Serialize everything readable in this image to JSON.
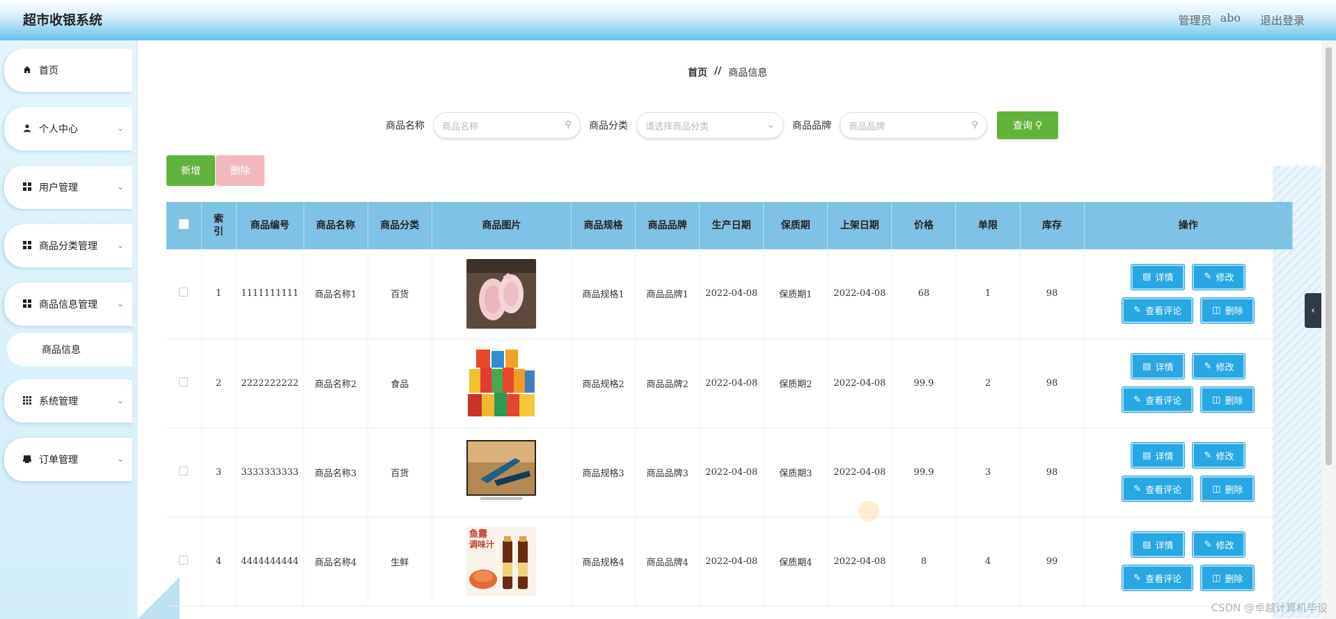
{
  "header": {
    "title": "超市收银系统",
    "user_role": "管理员",
    "user_name": "abo",
    "logout": "退出登录"
  },
  "sidebar": {
    "items": [
      {
        "label": "首页",
        "icon": "home-icon"
      },
      {
        "label": "个人中心",
        "icon": "user-icon"
      },
      {
        "label": "用户管理",
        "icon": "grid-icon"
      },
      {
        "label": "商品分类管理",
        "icon": "grid-icon"
      },
      {
        "label": "商品信息管理",
        "icon": "grid-icon"
      },
      {
        "label": "系统管理",
        "icon": "apps-icon"
      },
      {
        "label": "订单管理",
        "icon": "printer-icon"
      }
    ],
    "subitem": "商品信息"
  },
  "breadcrumb": {
    "home": "首页",
    "separator": "//",
    "current": "商品信息"
  },
  "search": {
    "name_label": "商品名称",
    "name_placeholder": "商品名称",
    "category_label": "商品分类",
    "category_placeholder": "请选择商品分类",
    "brand_label": "商品品牌",
    "brand_placeholder": "商品品牌",
    "query_button": "查询"
  },
  "actions": {
    "add": "新增",
    "delete": "删除"
  },
  "table": {
    "columns": [
      "索引",
      "商品编号",
      "商品名称",
      "商品分类",
      "商品图片",
      "商品规格",
      "商品品牌",
      "生产日期",
      "保质期",
      "上架日期",
      "价格",
      "单限",
      "库存",
      "操作"
    ],
    "rows": [
      {
        "index": "1",
        "code": "1111111111",
        "name": "商品名称1",
        "category": "百货",
        "image": "pink-shoes",
        "spec": "商品规格1",
        "brand": "商品品牌1",
        "prod_date": "2022-04-08",
        "shelf_life": "保质期1",
        "list_date": "2022-04-08",
        "price": "68",
        "limit": "1",
        "stock": "98"
      },
      {
        "index": "2",
        "code": "2222222222",
        "name": "商品名称2",
        "category": "食品",
        "image": "snack-bags",
        "spec": "商品规格2",
        "brand": "商品品牌2",
        "prod_date": "2022-04-08",
        "shelf_life": "保质期2",
        "list_date": "2022-04-08",
        "price": "99.9",
        "limit": "2",
        "stock": "98"
      },
      {
        "index": "3",
        "code": "3333333333",
        "name": "商品名称3",
        "category": "百货",
        "image": "tv-screen",
        "spec": "商品规格3",
        "brand": "商品品牌3",
        "prod_date": "2022-04-08",
        "shelf_life": "保质期3",
        "list_date": "2022-04-08",
        "price": "99.9",
        "limit": "3",
        "stock": "98"
      },
      {
        "index": "4",
        "code": "4444444444",
        "name": "商品名称4",
        "category": "生鲜",
        "image": "sauce-bottles",
        "spec": "商品规格4",
        "brand": "商品品牌4",
        "prod_date": "2022-04-08",
        "shelf_life": "保质期4",
        "list_date": "2022-04-08",
        "price": "8",
        "limit": "4",
        "stock": "99"
      }
    ],
    "row_actions": {
      "detail": "详情",
      "edit": "修改",
      "comments": "查看评论",
      "delete": "删除"
    }
  },
  "image4_text": {
    "title": "鱼露",
    "subtitle": "调味汁"
  },
  "watermark": "CSDN @卓越计算机毕设",
  "colors": {
    "accent_green": "#60b33b",
    "header_blue": "#7ec3e3",
    "action_blue": "#27a7e3",
    "delete_pink": "#f3b8be"
  }
}
